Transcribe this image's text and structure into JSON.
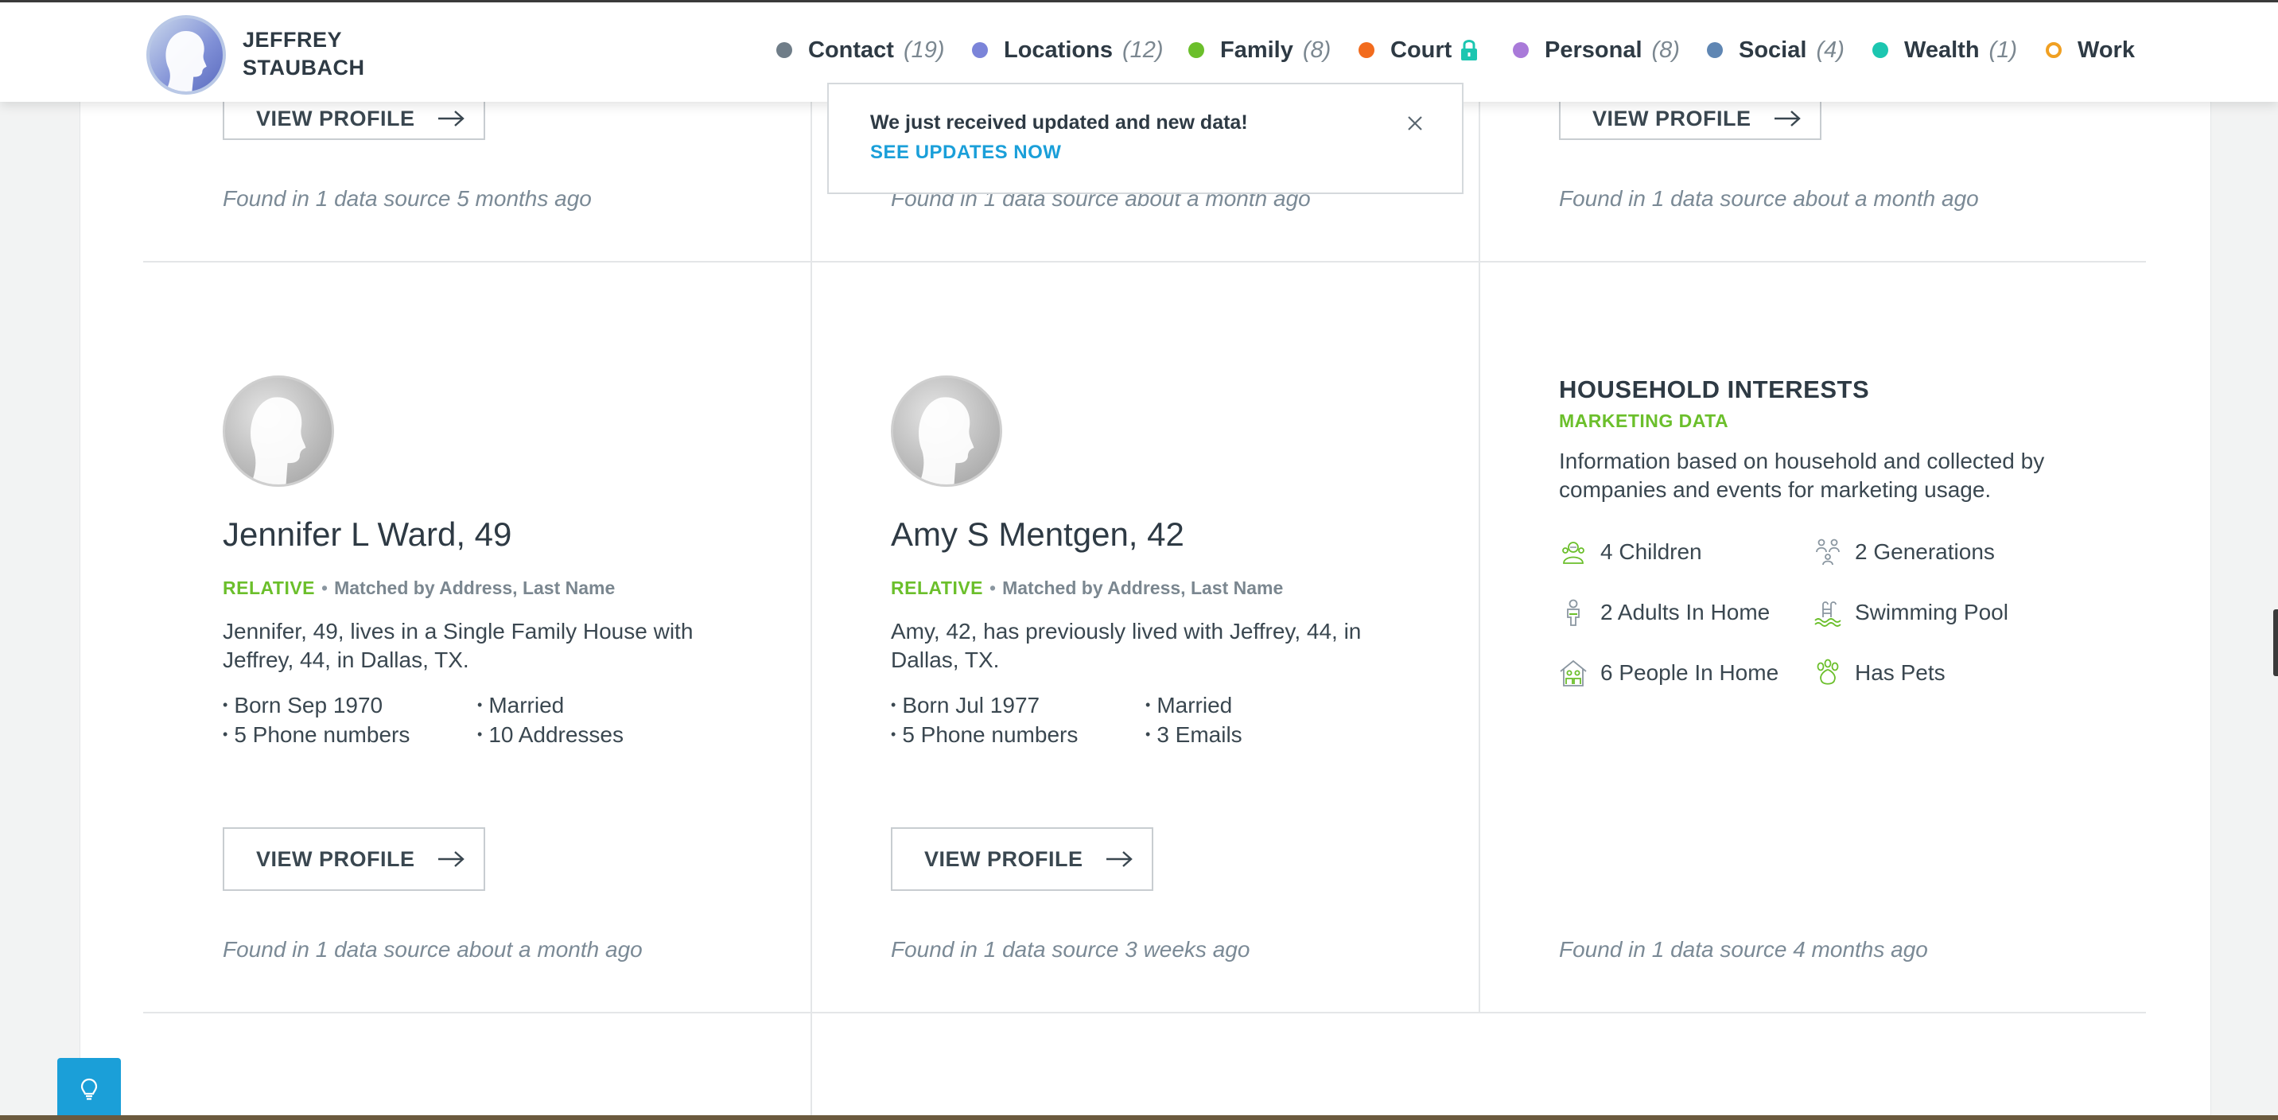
{
  "header": {
    "name_line1": "JEFFREY",
    "name_line2": "STAUBACH",
    "nav": [
      {
        "label": "Contact",
        "count": "(19)",
        "color": "#6f7d88"
      },
      {
        "label": "Locations",
        "count": "(12)",
        "color": "#7b84d9"
      },
      {
        "label": "Family",
        "count": "(8)",
        "color": "#6bbf2b"
      },
      {
        "label": "Court",
        "count": "",
        "color": "#f26b1d",
        "icon": "lock-icon"
      },
      {
        "label": "Personal",
        "count": "(8)",
        "color": "#a97ad9"
      },
      {
        "label": "Social",
        "count": "(4)",
        "color": "#5f86b3"
      },
      {
        "label": "Wealth",
        "count": "(1)",
        "color": "#1cc6b0"
      },
      {
        "label": "Work",
        "count": "",
        "color": "#f0a022",
        "style": "ring"
      }
    ]
  },
  "toast": {
    "message": "We just received updated and new data!",
    "link": "SEE UPDATES NOW"
  },
  "top_row": {
    "col1_button": "VIEW PROFILE",
    "col1_found": "Found in 1 data source 5 months ago",
    "col2_found": "Found in 1 data source about a month ago",
    "col3_button": "VIEW PROFILE",
    "col3_found": "Found in 1 data source about a month ago"
  },
  "people": [
    {
      "name": "Jennifer L Ward, 49",
      "relation": "RELATIVE",
      "match": "Matched by Address, Last Name",
      "description": "Jennifer, 49, lives in a Single Family House with Jeffrey, 44, in Dallas, TX.",
      "facts": [
        "Born Sep 1970",
        "Married",
        "5 Phone numbers",
        "10 Addresses"
      ],
      "button": "VIEW PROFILE",
      "found": "Found in 1 data source about a month ago"
    },
    {
      "name": "Amy S Mentgen, 42",
      "relation": "RELATIVE",
      "match": "Matched by Address, Last Name",
      "description": "Amy, 42, has previously lived with Jeffrey, 44, in Dallas, TX.",
      "facts": [
        "Born Jul 1977",
        "Married",
        "5 Phone numbers",
        "3 Emails"
      ],
      "button": "VIEW PROFILE",
      "found": "Found in 1 data source 3 weeks ago"
    }
  ],
  "household": {
    "title": "HOUSEHOLD INTERESTS",
    "subtitle": "MARKETING DATA",
    "description": "Information based on household and collected by companies and events for marketing usage.",
    "items": [
      {
        "label": "4 Children",
        "icon": "children-icon"
      },
      {
        "label": "2 Generations",
        "icon": "generations-icon"
      },
      {
        "label": "2 Adults In Home",
        "icon": "adult-icon"
      },
      {
        "label": "Swimming Pool",
        "icon": "pool-icon"
      },
      {
        "label": "6 People In Home",
        "icon": "home-people-icon"
      },
      {
        "label": "Has Pets",
        "icon": "paw-icon"
      }
    ],
    "found": "Found in 1 data source 4 months ago"
  },
  "colors": {
    "accent_green": "#6bbf2b",
    "link_blue": "#1a9fd9",
    "help_button": "#1b9fd8"
  }
}
